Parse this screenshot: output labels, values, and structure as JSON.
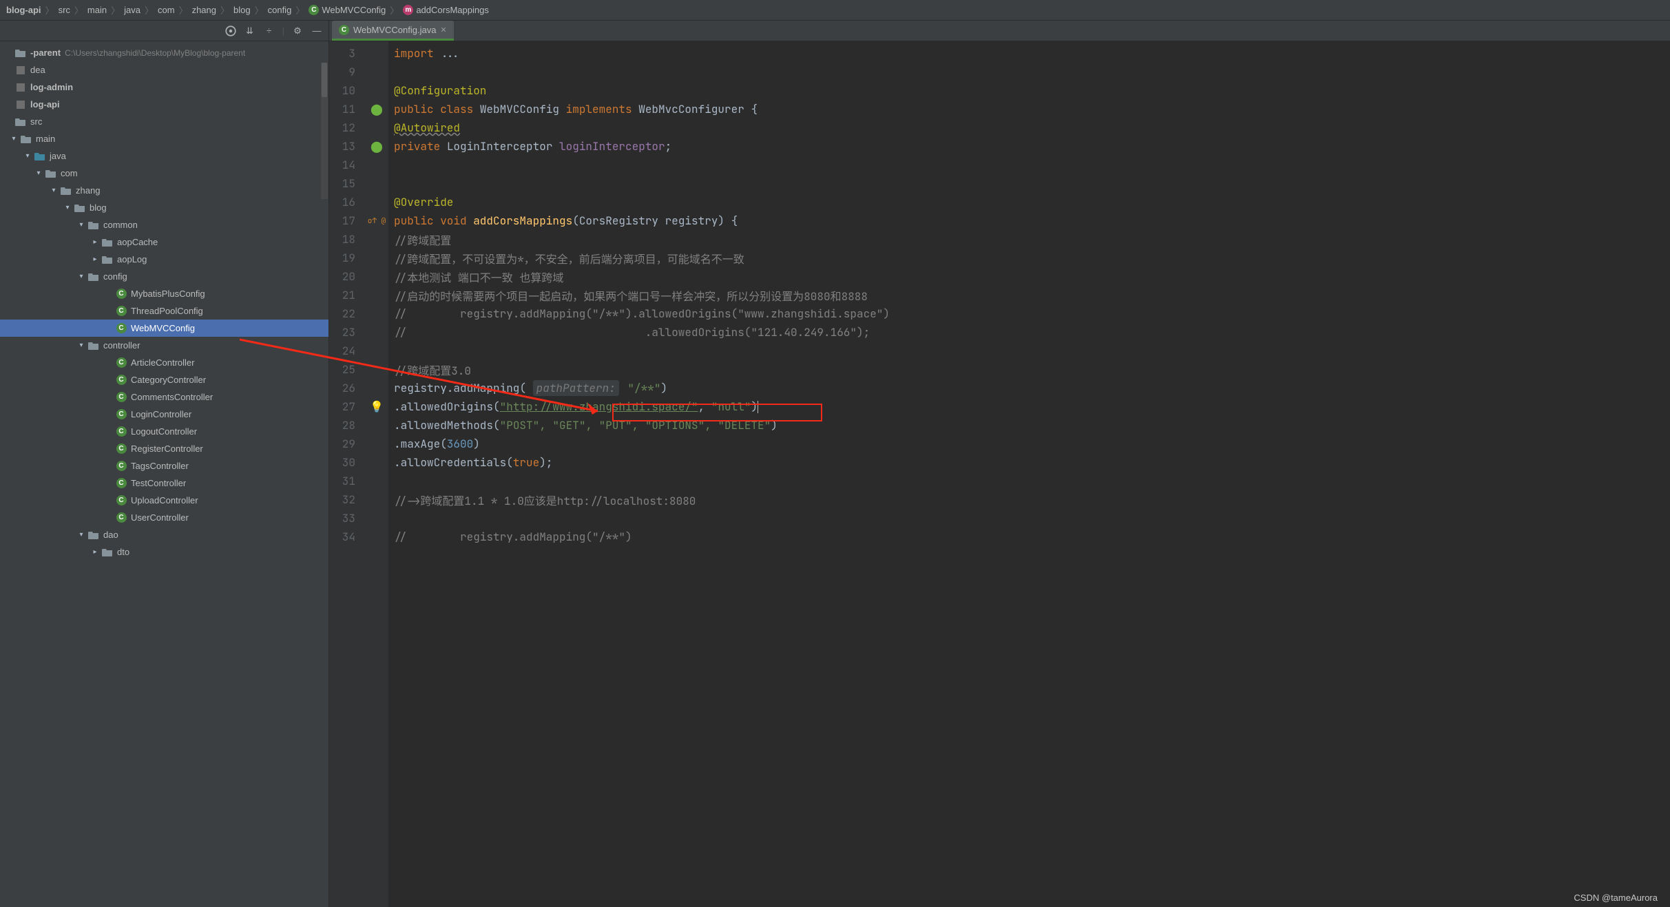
{
  "breadcrumbs": [
    "blog-api",
    "src",
    "main",
    "java",
    "com",
    "zhang",
    "blog",
    "config",
    "WebMVCConfig",
    "addCorsMappings"
  ],
  "crumb_icons": {
    "WebMVCConfig": "class-icon",
    "addCorsMappings": "method-icon"
  },
  "toolbar_icons": [
    "target",
    "expand",
    "divide",
    "gear",
    "minimize"
  ],
  "tree": [
    {
      "label": "-parent",
      "icon": "folder",
      "indent": 0,
      "arrow": "",
      "muted": true,
      "path": "C:\\Users\\zhangshidi\\Desktop\\MyBlog\\blog-parent"
    },
    {
      "label": "dea",
      "icon": "",
      "indent": 0,
      "arrow": ""
    },
    {
      "label": "log-admin",
      "icon": "",
      "indent": 0,
      "arrow": "",
      "muted": true
    },
    {
      "label": "log-api",
      "icon": "",
      "indent": 0,
      "arrow": "",
      "muted": true
    },
    {
      "label": "src",
      "icon": "folder",
      "indent": 1,
      "arrow": "none"
    },
    {
      "label": "main",
      "icon": "folder",
      "indent": 2,
      "arrow": "down"
    },
    {
      "label": "java",
      "icon": "folder",
      "indent": 3,
      "arrow": "down",
      "blue": true
    },
    {
      "label": "com",
      "icon": "folder",
      "indent": 4,
      "arrow": "down"
    },
    {
      "label": "zhang",
      "icon": "folder",
      "indent": 5,
      "arrow": "down"
    },
    {
      "label": "blog",
      "icon": "folder",
      "indent": 6,
      "arrow": "down"
    },
    {
      "label": "common",
      "icon": "folder",
      "indent": 7,
      "arrow": "down"
    },
    {
      "label": "aopCache",
      "icon": "folder",
      "indent": 8,
      "arrow": "right"
    },
    {
      "label": "aopLog",
      "icon": "folder",
      "indent": 8,
      "arrow": "right"
    },
    {
      "label": "config",
      "icon": "folder",
      "indent": 7,
      "arrow": "down"
    },
    {
      "label": "MybatisPlusConfig",
      "icon": "class",
      "indent": 9
    },
    {
      "label": "ThreadPoolConfig",
      "icon": "class",
      "indent": 9
    },
    {
      "label": "WebMVCConfig",
      "icon": "class",
      "indent": 9,
      "selected": true
    },
    {
      "label": "controller",
      "icon": "folder",
      "indent": 7,
      "arrow": "down"
    },
    {
      "label": "ArticleController",
      "icon": "class",
      "indent": 9
    },
    {
      "label": "CategoryController",
      "icon": "class",
      "indent": 9
    },
    {
      "label": "CommentsController",
      "icon": "class",
      "indent": 9
    },
    {
      "label": "LoginController",
      "icon": "class",
      "indent": 9
    },
    {
      "label": "LogoutController",
      "icon": "class",
      "indent": 9
    },
    {
      "label": "RegisterController",
      "icon": "class",
      "indent": 9
    },
    {
      "label": "TagsController",
      "icon": "class",
      "indent": 9
    },
    {
      "label": "TestController",
      "icon": "class",
      "indent": 9
    },
    {
      "label": "UploadController",
      "icon": "class",
      "indent": 9
    },
    {
      "label": "UserController",
      "icon": "class",
      "indent": 9
    },
    {
      "label": "dao",
      "icon": "folder",
      "indent": 7,
      "arrow": "down"
    },
    {
      "label": "dto",
      "icon": "folder",
      "indent": 8,
      "arrow": "right"
    }
  ],
  "open_tab": {
    "label": "WebMVCConfig.java",
    "icon": "class"
  },
  "line_numbers": [
    3,
    9,
    10,
    11,
    12,
    13,
    14,
    15,
    16,
    17,
    18,
    19,
    20,
    21,
    22,
    23,
    24,
    25,
    26,
    27,
    28,
    29,
    30,
    31,
    32,
    33,
    34
  ],
  "gutter_icons": {
    "11": "spring-bean",
    "13": "spring-bean",
    "17": "override",
    "27": "bulb"
  },
  "code": {
    "l3_import": "import ",
    "l3_dots": "...",
    "l9_blank": "",
    "l10_ann": "@Configuration",
    "l11_kw": "public class ",
    "l11_name": "WebMVCConfig ",
    "l11_impl": "implements ",
    "l11_intf": "WebMvcConfigurer ",
    "l11_brace": "{",
    "l12_ann": "@Autowired",
    "l13_kw": "private ",
    "l13_type": "LoginInterceptor ",
    "l13_field": "loginInterceptor",
    "l13_semi": ";",
    "l16_ann": "@Override",
    "l17_kw": "public void ",
    "l17_method": "addCorsMappings",
    "l17_params": "(CorsRegistry registry) {",
    "l18_c": "//跨域配置",
    "l19_c": "//跨域配置，不可设置为*，不安全，前后端分离项目，可能域名不一致",
    "l20_c": "//本地测试 端口不一致 也算跨域",
    "l21_c": "//启动的时候需要两个项目一起启动，如果两个端口号一样会冲突，所以分别设置为8080和8888",
    "l22_c": "//        registry.addMapping(\"/**\").allowedOrigins(\"www.zhangshidi.space\")",
    "l23_c": "//                                    .allowedOrigins(\"121.40.249.166\");",
    "l25_c": "//跨域配置3.0",
    "l26_a": "registry.",
    "l26_m": "addMapping",
    "l26_p1": "( ",
    "l26_hint": "pathPattern:",
    "l26_s": " \"/**\"",
    "l26_p2": ")",
    "l27_dot": ".",
    "l27_m": "allowedOrigins",
    "l27_p1": "(",
    "l27_s1": "\"http://www.zhangshidi.space/\"",
    "l27_comma": ", ",
    "l27_s2": "\"null\"",
    "l27_p2": ")",
    "l28_dot": ".",
    "l28_m": "allowedMethods",
    "l28_p1": "(",
    "l28_s": "\"POST\", \"GET\", \"PUT\", \"OPTIONS\", \"DELETE\"",
    "l28_p2": ")",
    "l29_dot": ".",
    "l29_m": "maxAge",
    "l29_p1": "(",
    "l29_n": "3600",
    "l29_p2": ")",
    "l30_dot": ".",
    "l30_m": "allowCredentials",
    "l30_p1": "(",
    "l30_b": "true",
    "l30_p2": ");",
    "l32_c": "//->跨域配置1.1 * 1.0应该是http://localhost:8080",
    "l34_c": "//        registry.addMapping(\"/**\")"
  },
  "watermark": "CSDN @tameAurora"
}
